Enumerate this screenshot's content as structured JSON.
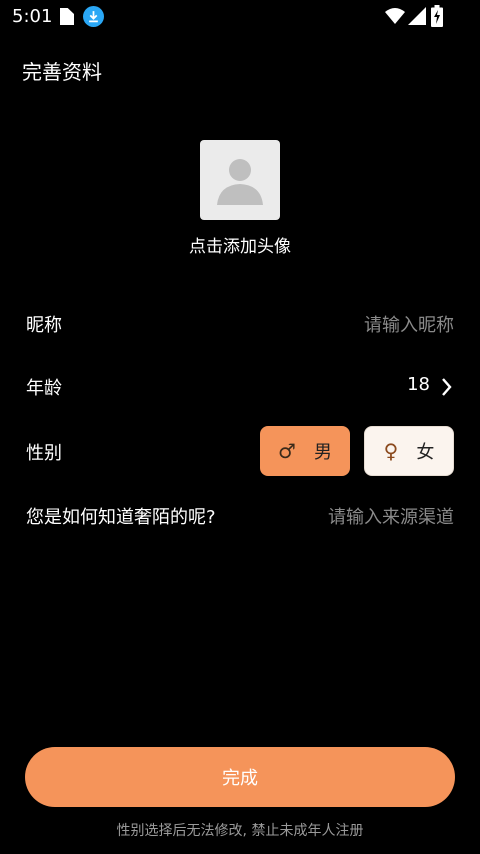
{
  "status_bar": {
    "time": "5:01"
  },
  "header": {
    "title": "完善资料"
  },
  "avatar": {
    "label": "点击添加头像",
    "icon": "person-placeholder-icon"
  },
  "form": {
    "nickname": {
      "label": "昵称",
      "placeholder": "请输入昵称"
    },
    "age": {
      "label": "年龄",
      "value": "18"
    },
    "gender": {
      "label": "性别",
      "options": [
        {
          "symbol": "♂",
          "label": "男",
          "selected": true
        },
        {
          "symbol": "♀",
          "label": "女",
          "selected": false
        }
      ]
    },
    "source": {
      "label": "您是如何知道奢陌的呢?",
      "placeholder": "请输入来源渠道"
    }
  },
  "footer": {
    "done_label": "完成",
    "note": "性别选择后无法修改, 禁止未成年人注册"
  },
  "colors": {
    "accent": "#f5945a",
    "background": "#000000"
  }
}
